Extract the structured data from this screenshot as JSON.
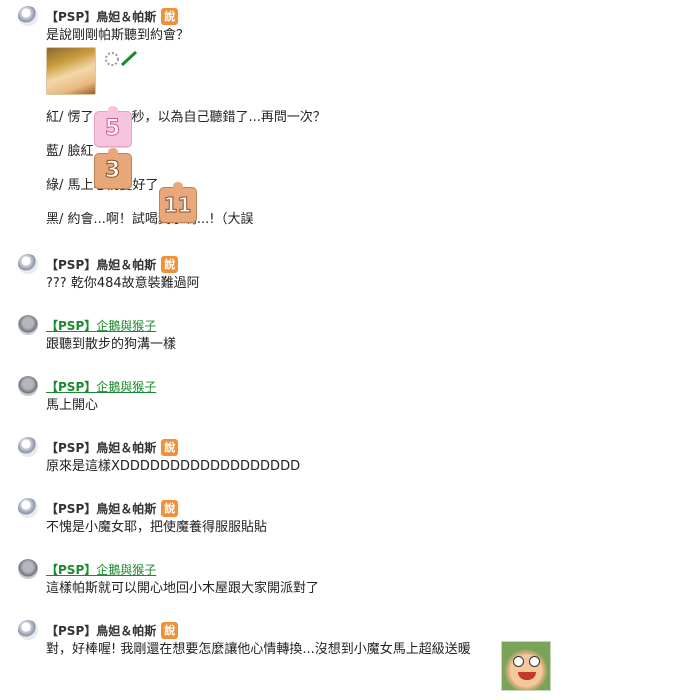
{
  "thread": [
    {
      "user": {
        "tag": "【PSP】",
        "name": "鳥妲＆帕斯",
        "style": "bold",
        "avatar": "avatar-bird-icon"
      },
      "say_badge": "說",
      "lines": [
        "是說剛剛帕斯聽到約會？",
        "",
        "紅/ 愣了",
        "秒，以為自己聽錯了...再問一次？",
        "藍/ 臉紅",
        "綠/ 馬上心情變好了",
        "黑/ 約會...啊！試喝糞水嗎...!（大誤"
      ],
      "stickers": {
        "five": "5",
        "three": "3",
        "eleven": "11"
      }
    },
    {
      "user": {
        "tag": "【PSP】",
        "name": "鳥妲＆帕斯",
        "style": "bold",
        "avatar": "avatar-bird-icon"
      },
      "say_badge": "說",
      "lines": [
        "??? 乾你484故意裝難過阿"
      ]
    },
    {
      "user": {
        "tag": "【PSP】",
        "name": "企鵝與猴子",
        "style": "green-link",
        "avatar": "avatar-penguin-icon"
      },
      "lines": [
        "跟聽到散步的狗溝一樣"
      ]
    },
    {
      "user": {
        "tag": "【PSP】",
        "name": "企鵝與猴子",
        "style": "green-link",
        "avatar": "avatar-penguin-icon"
      },
      "lines": [
        "馬上開心"
      ]
    },
    {
      "user": {
        "tag": "【PSP】",
        "name": "鳥妲＆帕斯",
        "style": "bold",
        "avatar": "avatar-bird-icon"
      },
      "say_badge": "說",
      "lines": [
        "原來是這樣XDDDDDDDDDDDDDDDDDD"
      ]
    },
    {
      "user": {
        "tag": "【PSP】",
        "name": "鳥妲＆帕斯",
        "style": "bold",
        "avatar": "avatar-bird-icon"
      },
      "say_badge": "說",
      "lines": [
        "不愧是小魔女耶，把使魔養得服服貼貼"
      ]
    },
    {
      "user": {
        "tag": "【PSP】",
        "name": "企鵝與猴子",
        "style": "green-link",
        "avatar": "avatar-penguin-icon"
      },
      "lines": [
        "這樣帕斯就可以開心地回小木屋跟大家開派對了"
      ]
    },
    {
      "user": {
        "tag": "【PSP】",
        "name": "鳥妲＆帕斯",
        "style": "bold",
        "avatar": "avatar-bird-icon"
      },
      "say_badge": "說",
      "lines": [
        "對，好棒喔! 我剛還在想要怎麼讓他心情轉換...沒想到小魔女馬上超級送暖"
      ]
    }
  ],
  "colors": {
    "say_badge": "#f0913a",
    "green_link": "#1a8a2e",
    "text": "#222222"
  }
}
